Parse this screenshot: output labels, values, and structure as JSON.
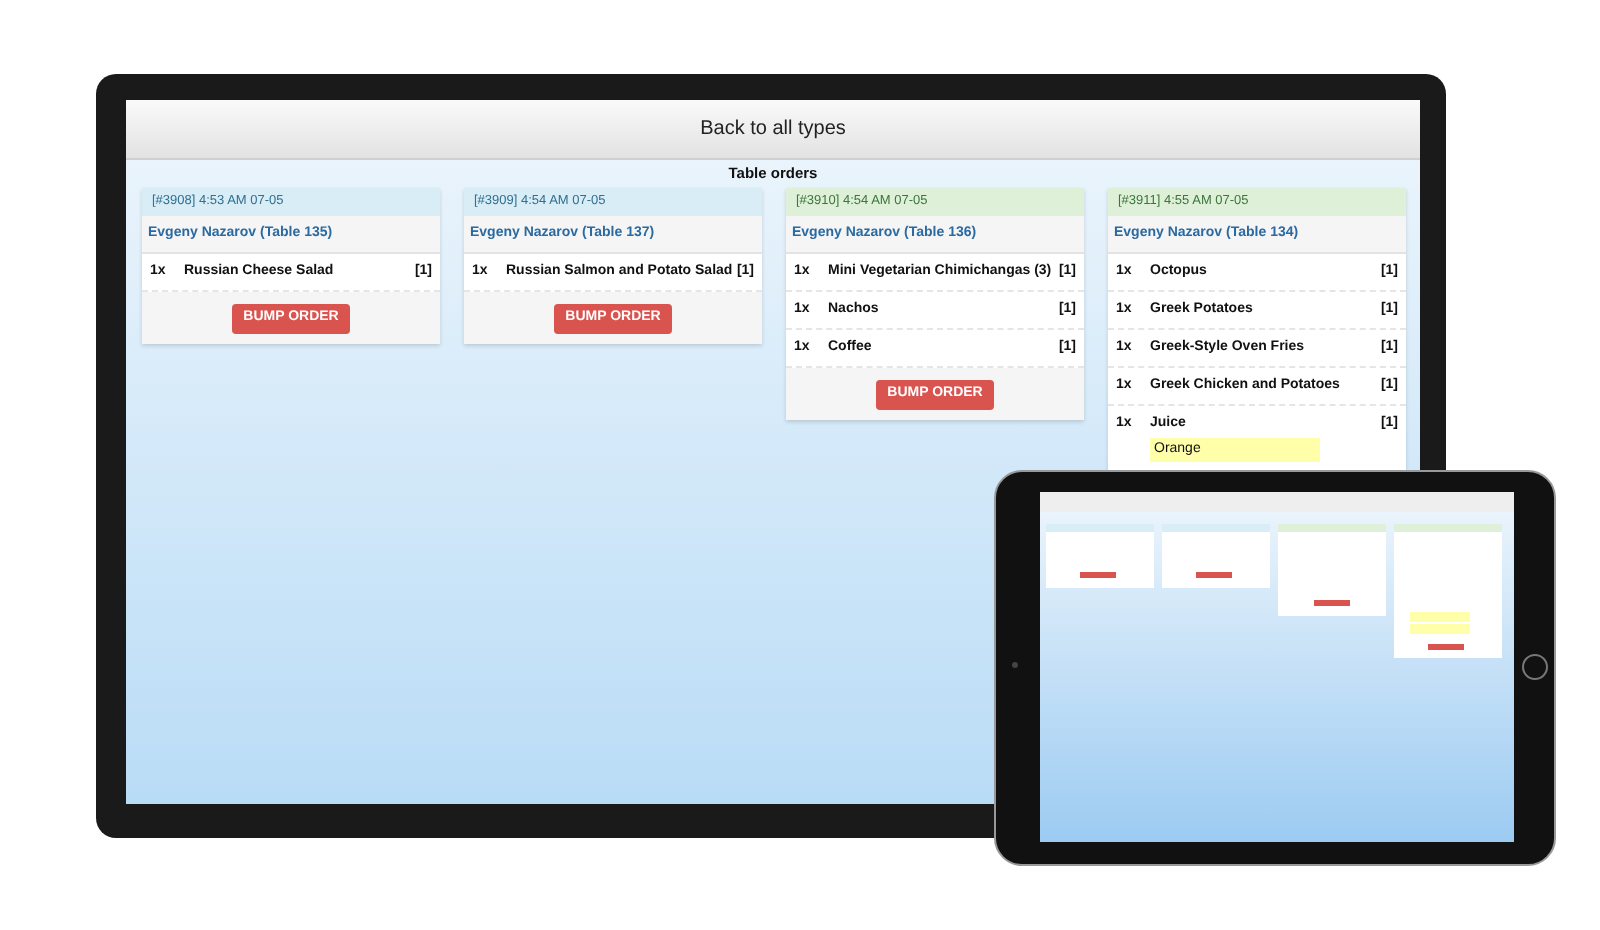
{
  "header": {
    "back_button": "Back to all types"
  },
  "section_title": "Table orders",
  "orders": [
    {
      "stamp": "[#3908] 4:53 AM 07-05",
      "color": "#d9edf7",
      "customer": "Evgeny Nazarov (Table 135)",
      "items": [
        {
          "qty": "1x",
          "name": "Russian Cheese Salad",
          "count": "[1]"
        }
      ],
      "button": "BUMP ORDER"
    },
    {
      "stamp": "[#3909] 4:54 AM 07-05",
      "color": "#d9edf7",
      "customer": "Evgeny Nazarov (Table 137)",
      "items": [
        {
          "qty": "1x",
          "name": "Russian Salmon and Potato Salad",
          "count": "[1]"
        }
      ],
      "button": "BUMP ORDER"
    },
    {
      "stamp": "[#3910] 4:54 AM 07-05",
      "color": "#dff0d8",
      "customer": "Evgeny Nazarov (Table 136)",
      "items": [
        {
          "qty": "1x",
          "name": "Mini Vegetarian Chimichangas (3)",
          "count": "[1]"
        },
        {
          "qty": "1x",
          "name": "Nachos",
          "count": "[1]"
        },
        {
          "qty": "1x",
          "name": "Coffee",
          "count": "[1]"
        }
      ],
      "button": "BUMP ORDER"
    },
    {
      "stamp": "[#3911] 4:55 AM 07-05",
      "color": "#dff0d8",
      "customer": "Evgeny Nazarov (Table 134)",
      "items": [
        {
          "qty": "1x",
          "name": "Octopus",
          "count": "[1]"
        },
        {
          "qty": "1x",
          "name": "Greek Potatoes",
          "count": "[1]"
        },
        {
          "qty": "1x",
          "name": "Greek-Style Oven Fries",
          "count": "[1]"
        },
        {
          "qty": "1x",
          "name": "Greek Chicken and Potatoes",
          "count": "[1]"
        },
        {
          "qty": "1x",
          "name": "Juice",
          "count": "[1]",
          "notes": [
            "Orange"
          ]
        }
      ]
    }
  ]
}
